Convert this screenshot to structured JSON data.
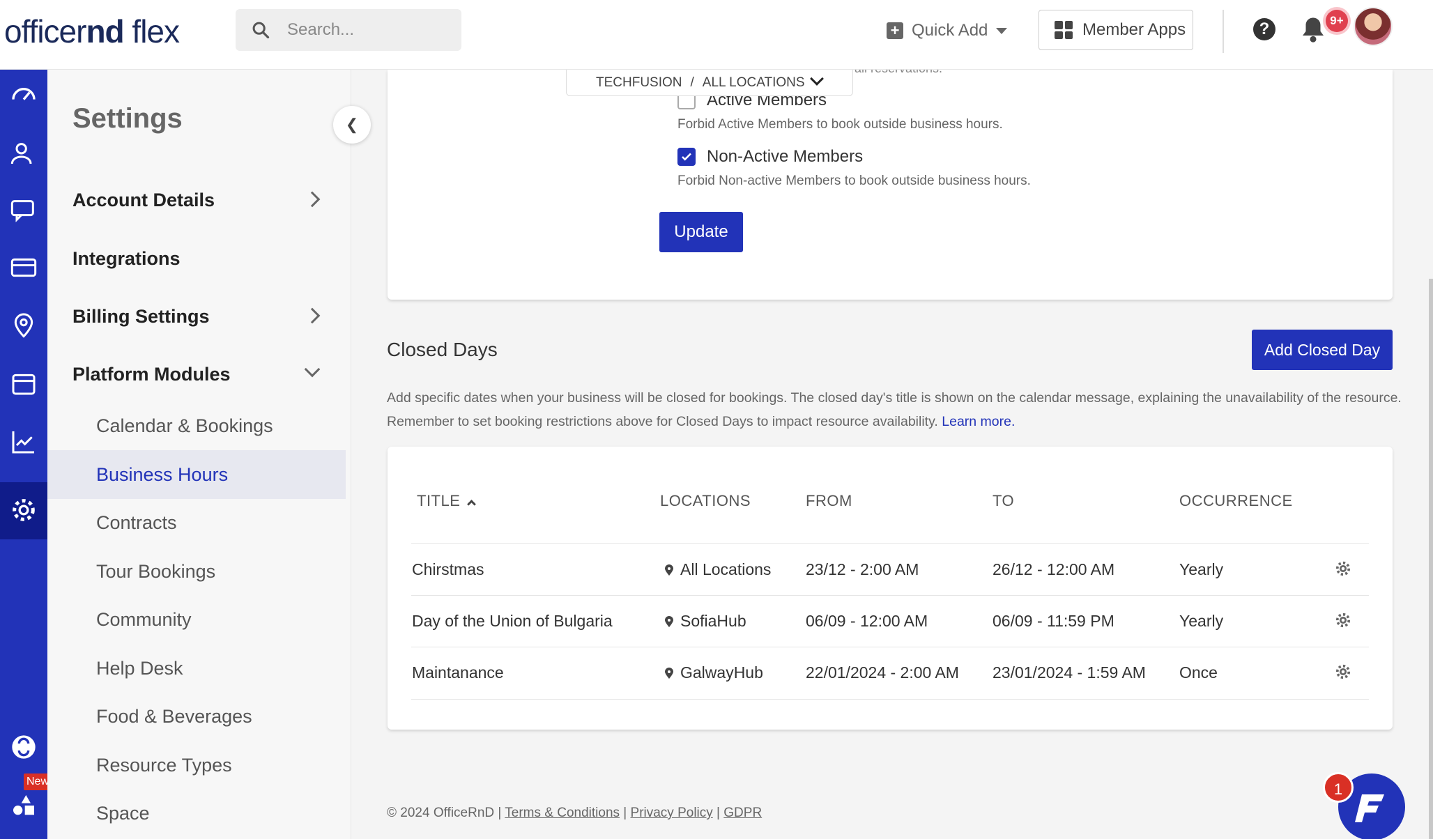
{
  "header": {
    "logo_light": "officer",
    "logo_bold": "nd",
    "logo_tail": " flex",
    "search_placeholder": "Search...",
    "quick_add": "Quick Add",
    "member_apps": "Member Apps",
    "notifications_badge": "9+"
  },
  "rail": {
    "new_badge": "New",
    "icons": [
      "dashboard-icon",
      "members-icon",
      "chat-icon",
      "billing-icon",
      "location-icon",
      "calendar-icon",
      "analytics-icon",
      "settings-icon",
      "support-icon",
      "apps-icon"
    ]
  },
  "sidebar": {
    "title": "Settings",
    "items": [
      {
        "label": "Account Details"
      },
      {
        "label": "Integrations"
      },
      {
        "label": "Billing Settings"
      },
      {
        "label": "Platform Modules"
      }
    ],
    "sub_items": [
      {
        "label": "Calendar & Bookings"
      },
      {
        "label": "Business Hours"
      },
      {
        "label": "Contracts"
      },
      {
        "label": "Tour Bookings"
      },
      {
        "label": "Community"
      },
      {
        "label": "Help Desk"
      },
      {
        "label": "Food & Beverages"
      },
      {
        "label": "Resource Types"
      },
      {
        "label": "Space"
      }
    ]
  },
  "location_selector": {
    "org": "TECHFUSION",
    "separator": "/",
    "location": "ALL LOCATIONS"
  },
  "restrictions": {
    "truncated_text": "all reservations.",
    "active_members_label": "Active Members",
    "active_members_desc": "Forbid Active Members to book outside business hours.",
    "active_members_checked": false,
    "nonactive_members_label": "Non-Active Members",
    "nonactive_members_desc": "Forbid Non-active Members to book outside business hours.",
    "nonactive_members_checked": true,
    "update_button": "Update"
  },
  "closed_days": {
    "title": "Closed Days",
    "add_button": "Add Closed Day",
    "description": "Add specific dates when your business will be closed for bookings. The closed day's title is shown on the calendar message, explaining the unavailability of the resource. Remember to set booking restrictions above for Closed Days to impact resource availability.",
    "learn_more": "Learn more.",
    "columns": [
      "TITLE",
      "LOCATIONS",
      "FROM",
      "TO",
      "OCCURRENCE"
    ],
    "rows": [
      {
        "title": "Chirstmas",
        "location": "All Locations",
        "from": "23/12 - 2:00 AM",
        "to": "26/12 - 12:00 AM",
        "occurrence": "Yearly"
      },
      {
        "title": "Day of the Union of Bulgaria",
        "location": "SofiaHub",
        "from": "06/09 - 12:00 AM",
        "to": "06/09 - 11:59 PM",
        "occurrence": "Yearly"
      },
      {
        "title": "Maintanance",
        "location": "GalwayHub",
        "from": "22/01/2024 - 2:00 AM",
        "to": "23/01/2024 - 1:59 AM",
        "occurrence": "Once"
      }
    ]
  },
  "footer": {
    "copyright": "© 2024 OfficeRnD |",
    "terms": "Terms & Conditions",
    "sep1": "|",
    "privacy": "Privacy Policy",
    "sep2": "|",
    "gdpr": "GDPR"
  },
  "chat": {
    "badge": "1"
  },
  "colors": {
    "brand": "#2233b8",
    "rail_active": "#101c8a",
    "badge": "#d93025"
  }
}
